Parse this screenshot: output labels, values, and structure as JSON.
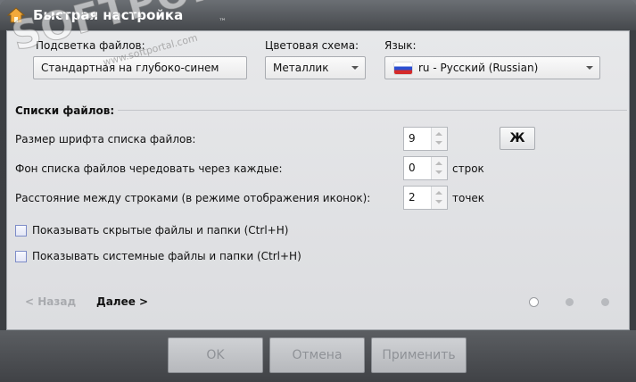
{
  "window": {
    "title": "Быстрая настройка"
  },
  "watermark": {
    "logo_text": "SOFTPORTAL",
    "tm": "™",
    "url": "www.softportal.com"
  },
  "fields": {
    "highlight_label": "Подсветка файлов:",
    "highlight_value": "Стандартная на глубоко-синем",
    "scheme_label": "Цветовая схема:",
    "scheme_value": "Металлик",
    "lang_label": "Язык:",
    "lang_value": "ru - Русский (Russian)"
  },
  "file_lists": {
    "section_title": "Списки файлов:",
    "font_size_label": "Размер шрифта списка файлов:",
    "font_size_value": "9",
    "bold_button": "Ж",
    "alternate_label": "Фон списка файлов чередовать через каждые:",
    "alternate_value": "0",
    "alternate_unit": "строк",
    "spacing_label": "Расстояние между строками (в режиме отображения иконок):",
    "spacing_value": "2",
    "spacing_unit": "точек",
    "show_hidden": "Показывать скрытые файлы и папки (Ctrl+H)",
    "show_system": "Показывать системные файлы и папки (Ctrl+H)"
  },
  "nav": {
    "back": "< Назад",
    "next": "Далее >",
    "page_count": 3,
    "current_page": 1
  },
  "footer": {
    "ok": "OK",
    "cancel": "Отмена",
    "apply": "Применить"
  },
  "colors": {
    "titlebar": "#45484c",
    "content_bg": "#e2e3e5",
    "checkbox_border": "#7d8cc8"
  }
}
